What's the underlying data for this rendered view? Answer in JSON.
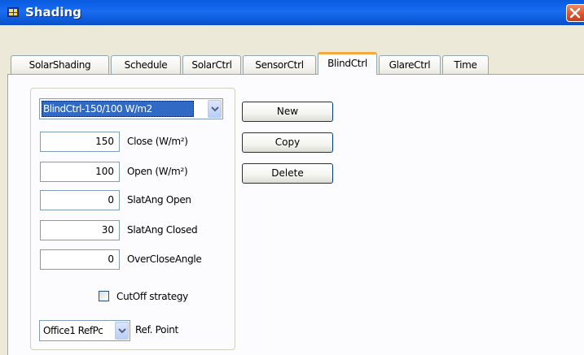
{
  "window": {
    "title": "Shading"
  },
  "tabs": [
    {
      "label": "SolarShading"
    },
    {
      "label": "Schedule"
    },
    {
      "label": "SolarCtrl"
    },
    {
      "label": "SensorCtrl"
    },
    {
      "label": "BlindCtrl"
    },
    {
      "label": "GlareCtrl"
    },
    {
      "label": "Time"
    }
  ],
  "active_tab": "BlindCtrl",
  "blindctrl": {
    "selector": {
      "value": "BlindCtrl-150/100 W/m2"
    },
    "fields": [
      {
        "value": "150",
        "label": "Close (W/m²)"
      },
      {
        "value": "100",
        "label": "Open (W/m²)"
      },
      {
        "value": "0",
        "label": "SlatAng Open"
      },
      {
        "value": "30",
        "label": "SlatAng Closed"
      },
      {
        "value": "0",
        "label": "OverCloseAngle"
      }
    ],
    "cutoff": {
      "label": "CutOff strategy",
      "checked": false
    },
    "refpoint": {
      "value": "Office1 RefPc",
      "label": "Ref. Point"
    }
  },
  "buttons": {
    "new": "New",
    "copy": "Copy",
    "delete": "Delete"
  },
  "colors": {
    "titlebar": "#0b5fe6",
    "selection": "#316ac5",
    "active_tab_accent": "#f5a83b",
    "close_button": "#d9532c"
  },
  "icons": {
    "app": "table-grid-icon",
    "close": "close-icon",
    "dropdown": "chevron-down-icon"
  }
}
